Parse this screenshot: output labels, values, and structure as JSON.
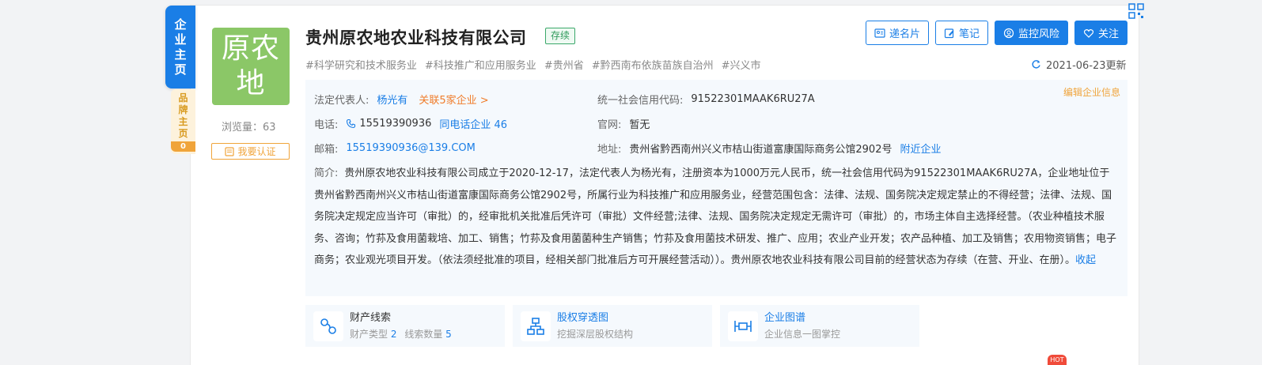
{
  "side_tabs": {
    "home": [
      "企",
      "业",
      "主",
      "页"
    ],
    "brand": [
      "品",
      "牌",
      "主",
      "页"
    ],
    "brand_count": "0"
  },
  "logo": {
    "line1": "原农",
    "line2": "地"
  },
  "views": "浏览量：63",
  "claim_label": "我要认证",
  "company": {
    "name": "贵州原农地农业科技有限公司",
    "status": "存续",
    "tags": [
      "#科学研究和技术服务业",
      "#科技推广和应用服务业",
      "#贵州省",
      "#黔西南布依族苗族自治州",
      "#兴义市"
    ]
  },
  "actions": {
    "card": "递名片",
    "note": "笔记",
    "monitor": "监控风险",
    "follow": "关注"
  },
  "update": "2021-06-23更新",
  "info": {
    "edit_label": "编辑企业信息",
    "legal_rep_label": "法定代表人:",
    "legal_rep": "杨光有",
    "related": "关联5家企业 >",
    "credit_code_label": "统一社会信用代码:",
    "credit_code": "91522301MAAK6RU27A",
    "phone_label": "电话:",
    "phone": "15519390936",
    "same_phone": "同电话企业 46",
    "website_label": "官网:",
    "website": "暂无",
    "email_label": "邮箱:",
    "email": "15519390936@139.COM",
    "address_label": "地址:",
    "address": "贵州省黔西南州兴义市桔山街道富康国际商务公馆2902号",
    "nearby": "附近企业",
    "intro_label": "简介:",
    "intro": "贵州原农地农业科技有限公司成立于2020-12-17，法定代表人为杨光有，注册资本为1000万元人民币，统一社会信用代码为91522301MAAK6RU27A，企业地址位于贵州省黔西南州兴义市桔山街道富康国际商务公馆2902号，所属行业为科技推广和应用服务业，经营范围包含：法律、法规、国务院决定规定禁止的不得经营；法律、法规、国务院决定规定应当许可（审批）的，经审批机关批准后凭许可（审批）文件经营;法律、法规、国务院决定规定无需许可（审批）的，市场主体自主选择经营。（农业种植技术服务、咨询；竹荪及食用菌栽培、加工、销售；竹荪及食用菌菌种生产销售；竹荪及食用菌技术研发、推广、应用；农业产业开发；农产品种植、加工及销售；农用物资销售；电子商务；农业观光项目开发。（依法须经批准的项目，经相关部门批准后方可开展经营活动））。贵州原农地农业科技有限公司目前的经营状态为存续（在营、开业、在册）。",
    "collapse": "收起"
  },
  "features": [
    {
      "title": "财产线索",
      "sub_a": "财产类型",
      "sub_a_val": "2",
      "sub_b": "线索数量",
      "sub_b_val": "5"
    },
    {
      "title": "股权穿透图",
      "sub": "挖掘深层股权结构"
    },
    {
      "title": "企业图谱",
      "sub": "企业信息一图掌控"
    }
  ],
  "hot_badge": "HOT",
  "colors": {
    "primary": "#1a7ee6",
    "logo_bg": "#8bc767",
    "status_green": "#2f9a5b",
    "orange": "#f07c2a",
    "gold": "#f0a43a"
  }
}
